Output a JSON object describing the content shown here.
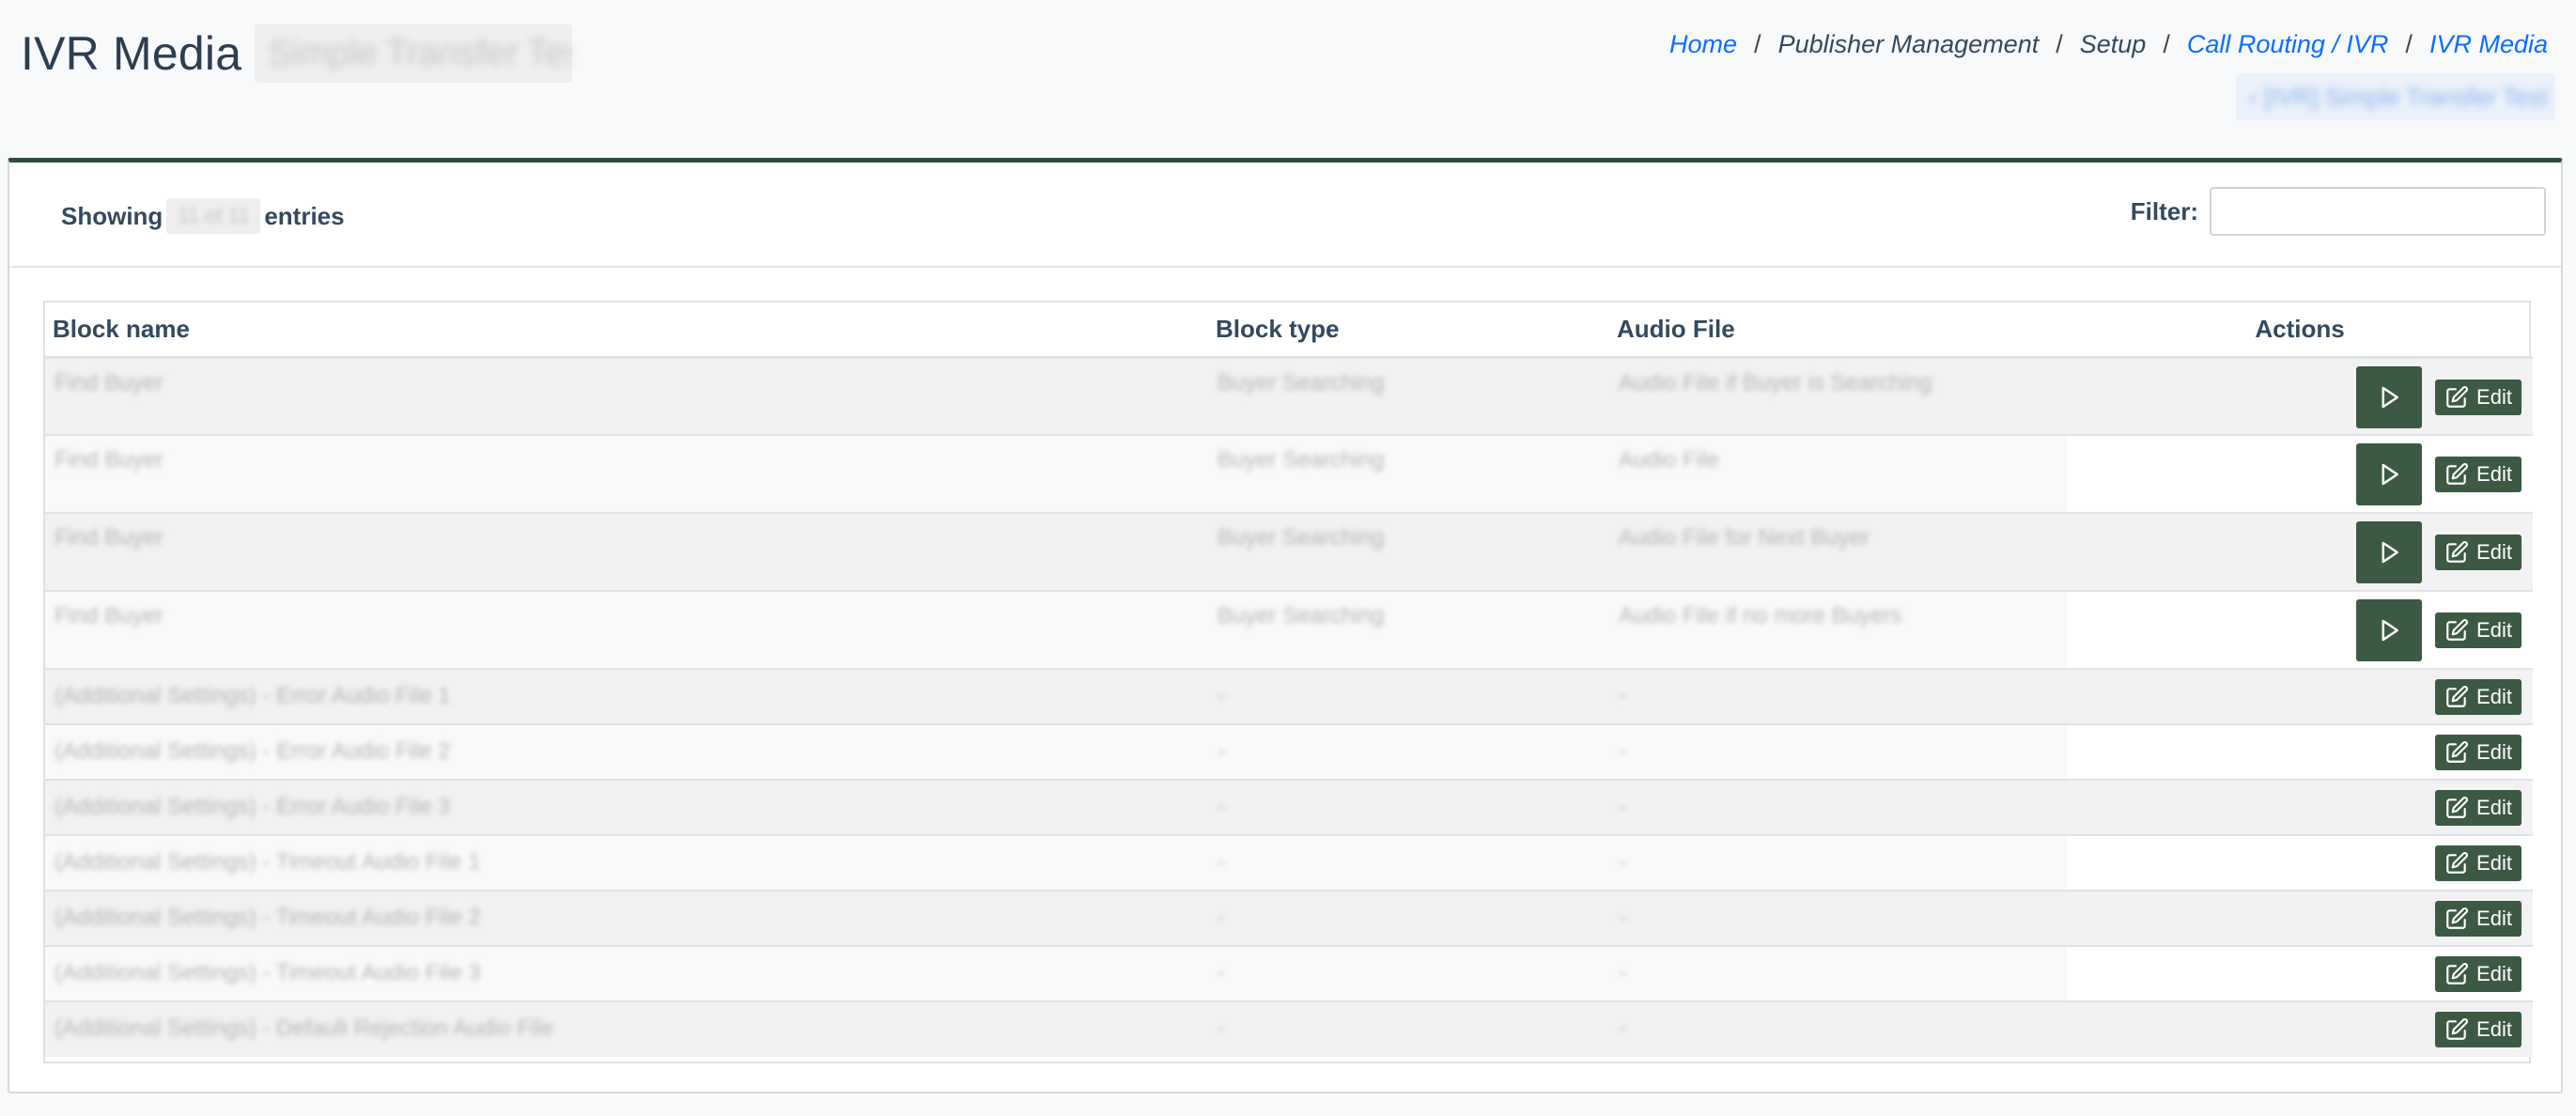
{
  "header": {
    "title": "IVR Media",
    "title_subject": "Simple Transfer Test",
    "breadcrumb": [
      {
        "label": "Home",
        "link": true
      },
      {
        "label": "Publisher Management",
        "link": false
      },
      {
        "label": "Setup",
        "link": false
      },
      {
        "label": "Call Routing / IVR",
        "link": true
      },
      {
        "label": "IVR Media",
        "link": true
      }
    ],
    "breadcrumb_sub": "‹ [IVR] Simple Transfer Test"
  },
  "toolbar": {
    "showing_label": "Showing",
    "showing_count": "11 of 11",
    "entries_label": "entries",
    "filter_label": "Filter:",
    "filter_value": "",
    "filter_placeholder": ""
  },
  "table": {
    "columns": [
      "Block name",
      "Block type",
      "Audio File",
      "Actions"
    ],
    "edit_label": "Edit",
    "rows": [
      {
        "name": "Find Buyer",
        "type": "Buyer Searching",
        "audio": "Audio File if Buyer is Searching",
        "playable": true
      },
      {
        "name": "Find Buyer",
        "type": "Buyer Searching",
        "audio": "Audio File",
        "playable": true
      },
      {
        "name": "Find Buyer",
        "type": "Buyer Searching",
        "audio": "Audio File for Next Buyer",
        "playable": true
      },
      {
        "name": "Find Buyer",
        "type": "Buyer Searching",
        "audio": "Audio File if no more Buyers",
        "playable": true
      },
      {
        "name": "(Additional Settings) - Error Audio File 1",
        "type": "-",
        "audio": "-",
        "playable": false
      },
      {
        "name": "(Additional Settings) - Error Audio File 2",
        "type": "-",
        "audio": "-",
        "playable": false
      },
      {
        "name": "(Additional Settings) - Error Audio File 3",
        "type": "-",
        "audio": "-",
        "playable": false
      },
      {
        "name": "(Additional Settings) - Timeout Audio File 1",
        "type": "-",
        "audio": "-",
        "playable": false
      },
      {
        "name": "(Additional Settings) - Timeout Audio File 2",
        "type": "-",
        "audio": "-",
        "playable": false
      },
      {
        "name": "(Additional Settings) - Timeout Audio File 3",
        "type": "-",
        "audio": "-",
        "playable": false
      },
      {
        "name": "(Additional Settings) - Default Rejection Audio File",
        "type": "-",
        "audio": "-",
        "playable": false
      }
    ]
  },
  "icons": {
    "play": "play-icon",
    "edit": "edit-icon"
  },
  "colors": {
    "accent_green": "#3b5943",
    "link_blue": "#0d6efd",
    "text_dark": "#34495e"
  }
}
